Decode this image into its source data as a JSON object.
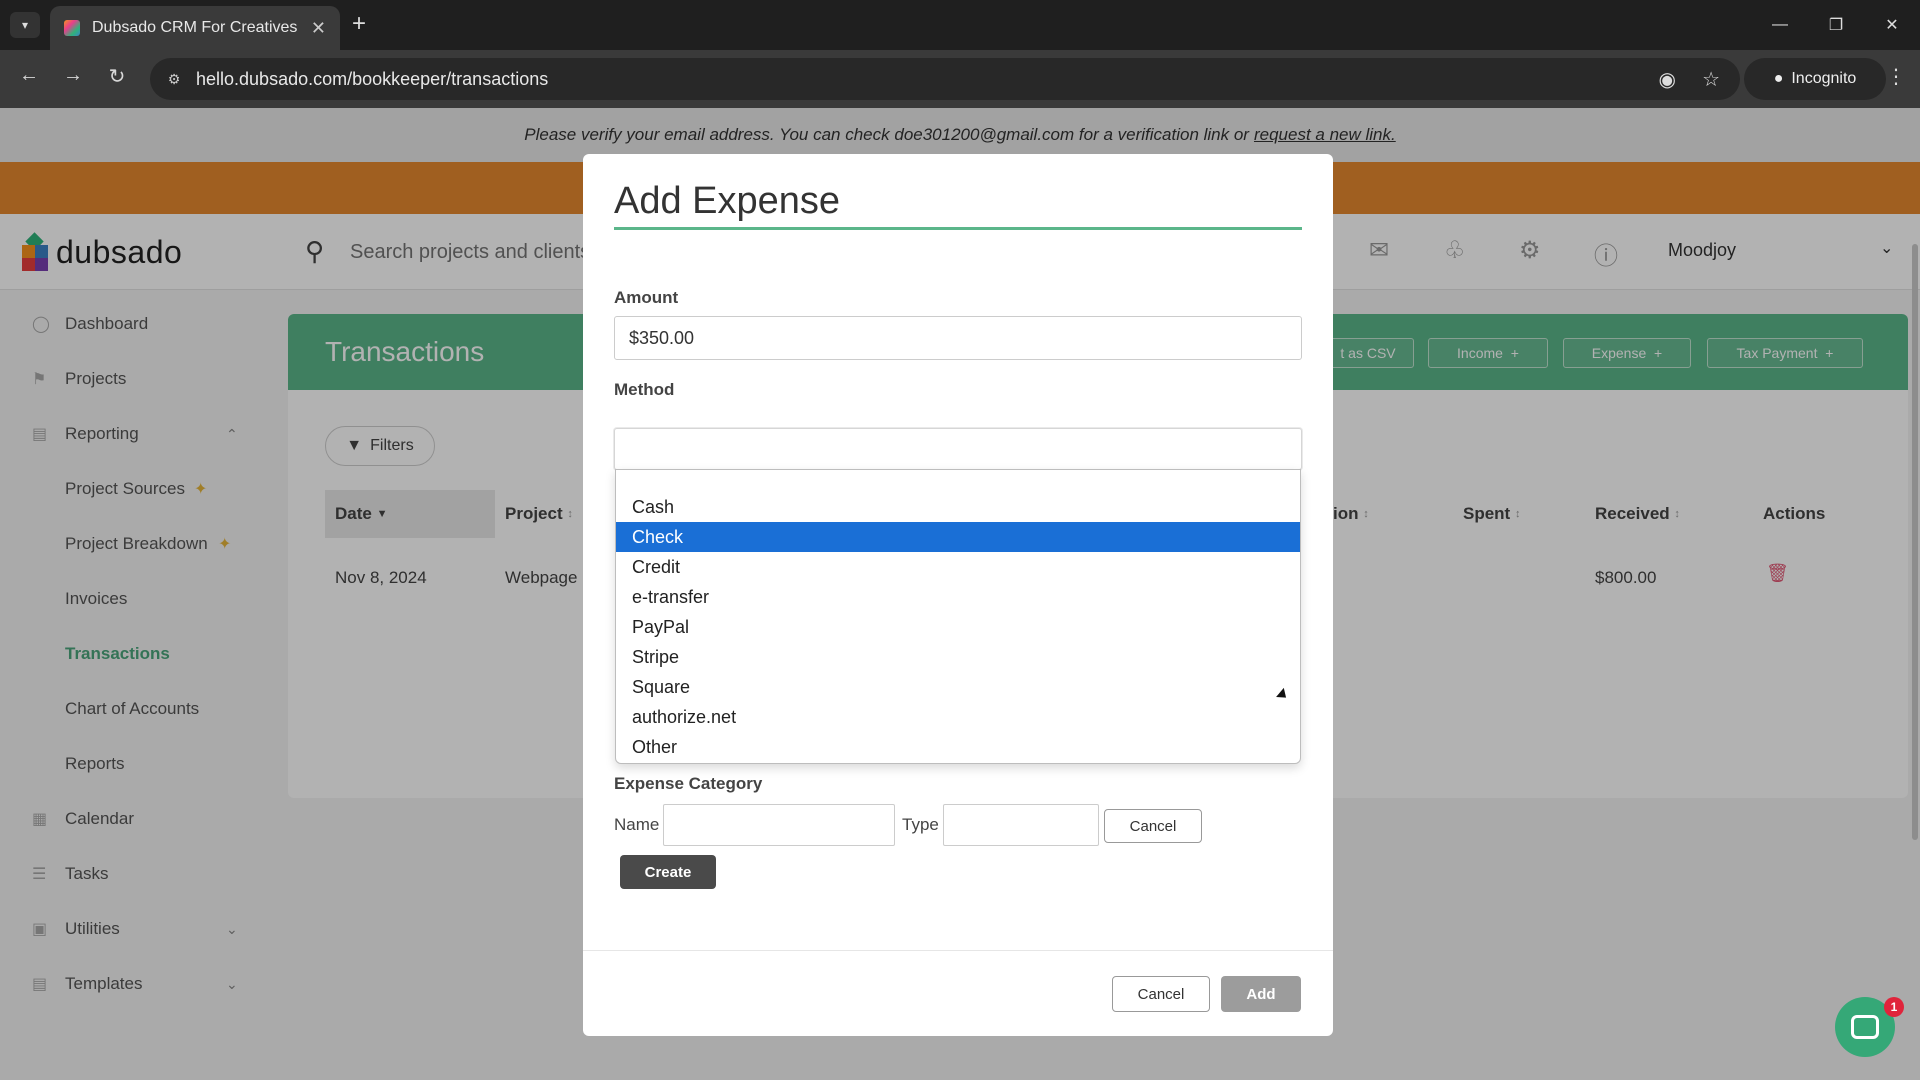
{
  "browser": {
    "tab_title": "Dubsado CRM For Creatives",
    "url": "hello.dubsado.com/bookkeeper/transactions",
    "incognito_label": "Incognito"
  },
  "banner": {
    "text": "Please verify your email address. You can check doe301200@gmail.com for a verification link or",
    "link": "request a new link."
  },
  "app": {
    "logo_text": "dubsado",
    "search_placeholder": "Search projects and clients",
    "user_name": "Moodjoy"
  },
  "sidebar": {
    "items": [
      {
        "label": "Dashboard",
        "icon": "dashboard-icon"
      },
      {
        "label": "Projects",
        "icon": "projects-icon"
      },
      {
        "label": "Reporting",
        "icon": "reporting-icon"
      },
      {
        "label": "Project Sources"
      },
      {
        "label": "Project Breakdown"
      },
      {
        "label": "Invoices"
      },
      {
        "label": "Transactions"
      },
      {
        "label": "Chart of Accounts"
      },
      {
        "label": "Reports"
      },
      {
        "label": "Calendar",
        "icon": "calendar-icon"
      },
      {
        "label": "Tasks",
        "icon": "tasks-icon"
      },
      {
        "label": "Utilities",
        "icon": "utilities-icon"
      },
      {
        "label": "Templates",
        "icon": "templates-icon"
      }
    ]
  },
  "transactions": {
    "title": "Transactions",
    "buttons": {
      "export": "t as CSV",
      "income": "Income",
      "expense": "Expense",
      "tax": "Tax Payment"
    },
    "filters_label": "Filters",
    "columns": {
      "date": "Date",
      "project": "Project",
      "description": "ion",
      "spent": "Spent",
      "received": "Received",
      "actions": "Actions"
    },
    "rows": [
      {
        "date": "Nov 8, 2024",
        "project": "Webpage",
        "received": "$800.00"
      }
    ]
  },
  "modal": {
    "title": "Add Expense",
    "amount_label": "Amount",
    "amount_value": "$350.00",
    "method_label": "Method",
    "method_options": [
      "Cash",
      "Check",
      "Credit",
      "e-transfer",
      "PayPal",
      "Stripe",
      "Square",
      "authorize.net",
      "Other"
    ],
    "method_highlighted": "Check",
    "expense_category_label": "Expense Category",
    "name_label": "Name",
    "type_label": "Type",
    "cancel_small": "Cancel",
    "create": "Create",
    "cancel": "Cancel",
    "add": "Add"
  },
  "chat": {
    "badge": "1"
  },
  "colors": {
    "accent": "#5bb68a",
    "banner_orange": "#e6892f",
    "selected": "#1a6fd6"
  }
}
